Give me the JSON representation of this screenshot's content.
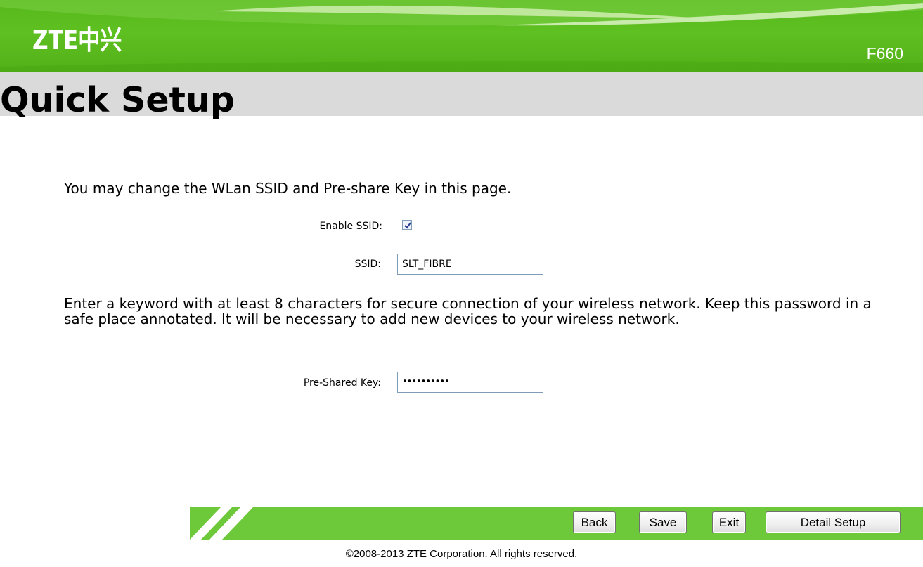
{
  "header": {
    "logo_text": "ZTE中兴",
    "model": "F660",
    "brand_color": "#5cbd1f"
  },
  "page": {
    "title": "Quick Setup",
    "intro": "You may change the WLan SSID and Pre-share Key in this page.",
    "note": "Enter a keyword with at least 8 characters for secure connection of your wireless network. Keep this password in a safe place annotated. It will be necessary to add new devices to your wireless network."
  },
  "form": {
    "enable_ssid_label": "Enable SSID:",
    "enable_ssid_checked": true,
    "ssid_label": "SSID:",
    "ssid_value": "SLT_FIBRE",
    "psk_label": "Pre-Shared Key:",
    "psk_value": "••••••••••"
  },
  "buttons": {
    "back": "Back",
    "save": "Save",
    "exit": "Exit",
    "detail": "Detail Setup"
  },
  "footer": {
    "copyright": "©2008-2013 ZTE Corporation. All rights reserved."
  }
}
